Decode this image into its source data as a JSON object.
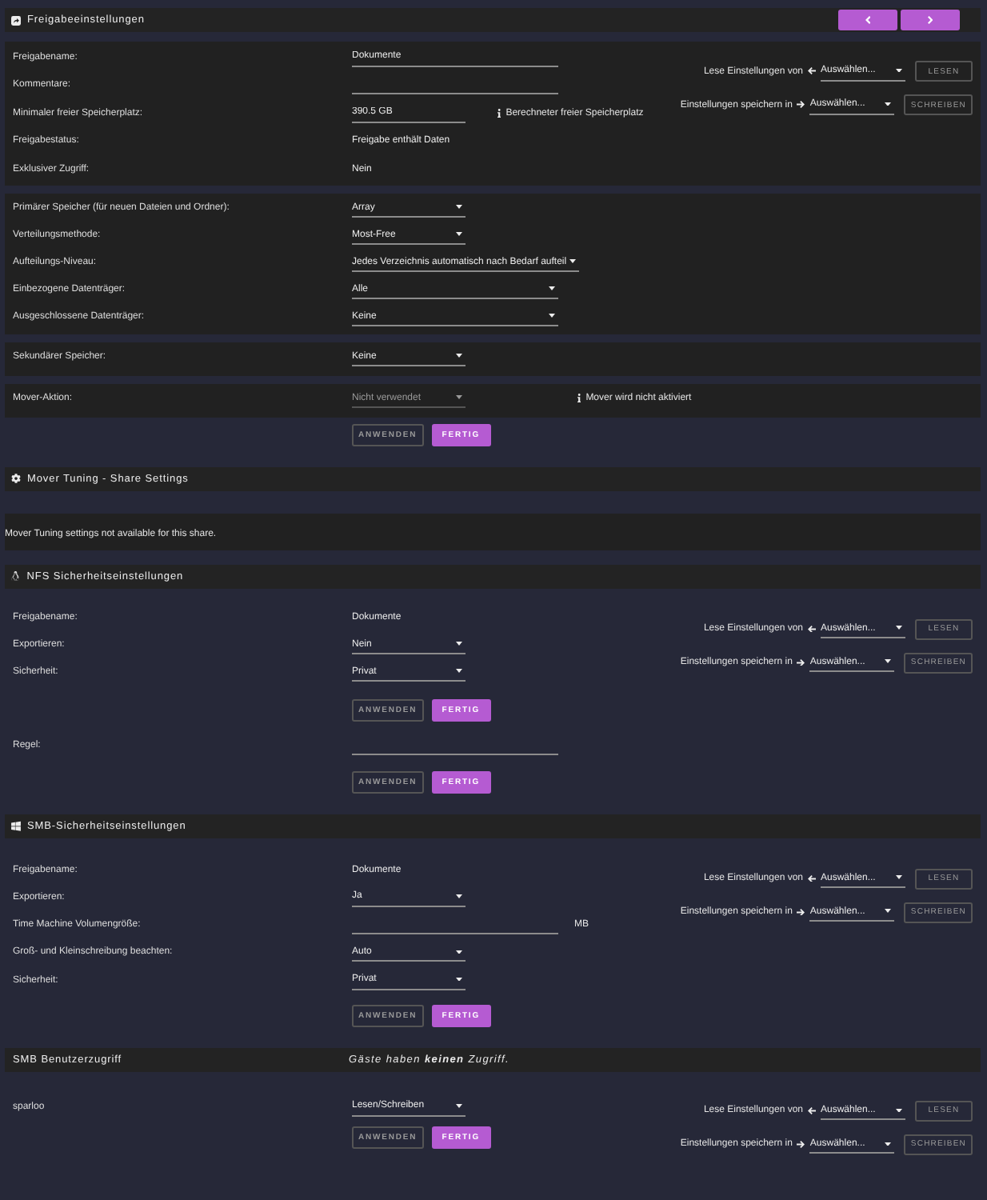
{
  "share_settings": {
    "title": "Freigabeeinstellungen",
    "nav_buttons": [
      {
        "kind": "previous"
      },
      {
        "kind": "next"
      }
    ],
    "panels": [
      {
        "rows": [
          {
            "kind": "widefield",
            "label": "Freigabename:",
            "value": "Dokumente"
          },
          {
            "kind": "widefield",
            "label": "Kommentare:"
          },
          {
            "kind": "field",
            "label": "Minimaler freier Speicherplatz:",
            "value": "390.5 GB",
            "note": "Berechneter freier Speicherplatz"
          },
          {
            "kind": "text",
            "label": "Freigabestatus:",
            "value": "Freigabe enthält Daten"
          },
          {
            "kind": "text",
            "label": "Exklusiver Zugriff:",
            "value": "Nein"
          }
        ],
        "presets": [
          {
            "kind": "read",
            "label": "Lese Einstellungen von",
            "select": "Auswählen...",
            "button": "LESEN",
            "disabled": true
          },
          {
            "kind": "write",
            "label": "Einstellungen speichern in",
            "select": "Auswählen...",
            "button": "SCHREIBEN",
            "disabled": true
          }
        ]
      },
      {
        "rows": [
          {
            "kind": "select",
            "label": "Primärer Speicher (für neuen Dateien und Ordner):",
            "value": "Array",
            "disabled": false
          },
          {
            "kind": "select",
            "label": "Verteilungsmethode:",
            "value": "Most-Free",
            "disabled": false
          },
          {
            "kind": "wideselect",
            "label": "Aufteilungs-Niveau:",
            "value": "Jedes Verzeichnis automatisch nach Bedarf aufteil",
            "disabled": false
          },
          {
            "kind": "wideselect",
            "label": "Einbezogene Datenträger:",
            "value": "Alle",
            "disabled": false
          },
          {
            "kind": "wideselect",
            "label": "Ausgeschlossene Datenträger:",
            "value": "Keine",
            "disabled": false
          }
        ]
      },
      {
        "rows": [
          {
            "kind": "select",
            "label": "Sekundärer Speicher:",
            "value": "Keine",
            "disabled": false
          }
        ]
      },
      {
        "rows": [
          {
            "kind": "select",
            "label": "Mover-Aktion:",
            "value": "Nicht verwendet",
            "disabled": true,
            "note": "Mover wird nicht aktiviert"
          }
        ]
      }
    ],
    "actions": [
      {
        "label": "ANWENDEN",
        "disabled": true
      },
      {
        "label": "FERTIG",
        "disabled": false
      }
    ]
  },
  "mover_tuning": {
    "title": "Mover Tuning - Share Settings",
    "message": "Mover Tuning settings not available for this share."
  },
  "nfs_security": {
    "title": "NFS Sicherheitseinstellungen",
    "rows": [
      {
        "kind": "text",
        "label": "Freigabename:",
        "value": "Dokumente"
      },
      {
        "kind": "select",
        "label": "Exportieren:",
        "value": "Nein",
        "disabled": false
      },
      {
        "kind": "select",
        "label": "Sicherheit:",
        "value": "Privat",
        "disabled": false
      }
    ],
    "actions": [
      {
        "label": "ANWENDEN",
        "disabled": true
      },
      {
        "label": "FERTIG",
        "disabled": false
      }
    ],
    "rule_rows": [
      {
        "kind": "widefield",
        "label": "Regel:"
      }
    ],
    "rule_actions": [
      {
        "label": "ANWENDEN",
        "disabled": true
      },
      {
        "label": "FERTIG",
        "disabled": false
      }
    ],
    "presets": [
      {
        "kind": "read",
        "label": "Lese Einstellungen von",
        "select": "Auswählen...",
        "button": "LESEN",
        "disabled": true
      },
      {
        "kind": "write",
        "label": "Einstellungen speichern in",
        "select": "Auswählen...",
        "button": "SCHREIBEN",
        "disabled": true
      }
    ]
  },
  "smb_security": {
    "title": "SMB-Sicherheitseinstellungen",
    "rows": [
      {
        "kind": "text",
        "label": "Freigabename:",
        "value": "Dokumente"
      },
      {
        "kind": "select",
        "label": "Exportieren:",
        "value": "Ja",
        "disabled": false
      },
      {
        "kind": "widefield",
        "label": "Time Machine Volumengröße:",
        "unit": "MB"
      },
      {
        "kind": "select",
        "label": "Groß- und Kleinschreibung beachten:",
        "value": "Auto",
        "disabled": false
      },
      {
        "kind": "select",
        "label": "Sicherheit:",
        "value": "Privat",
        "disabled": false
      }
    ],
    "actions": [
      {
        "label": "ANWENDEN",
        "disabled": true
      },
      {
        "label": "FERTIG",
        "disabled": false
      }
    ],
    "presets": [
      {
        "kind": "read",
        "label": "Lese Einstellungen von",
        "select": "Auswählen...",
        "button": "LESEN",
        "disabled": true
      },
      {
        "kind": "write",
        "label": "Einstellungen speichern in",
        "select": "Auswählen...",
        "button": "SCHREIBEN",
        "disabled": true
      }
    ]
  },
  "smb_user_access": {
    "title": "SMB Benutzerzugriff",
    "notice": "Gäste haben **keinen** Zugriff.",
    "users": [
      {
        "kind": "select",
        "label": "sparloo",
        "value": "Lesen/Schreiben",
        "disabled": false
      }
    ],
    "actions": [
      {
        "label": "ANWENDEN",
        "disabled": true
      },
      {
        "label": "FERTIG",
        "disabled": false
      }
    ],
    "presets": [
      {
        "kind": "read",
        "label": "Lese Einstellungen von",
        "select": "Auswählen...",
        "button": "LESEN",
        "disabled": true
      },
      {
        "kind": "write",
        "label": "Einstellungen speichern in",
        "select": "Auswählen...",
        "button": "SCHREIBEN",
        "disabled": true
      }
    ]
  }
}
